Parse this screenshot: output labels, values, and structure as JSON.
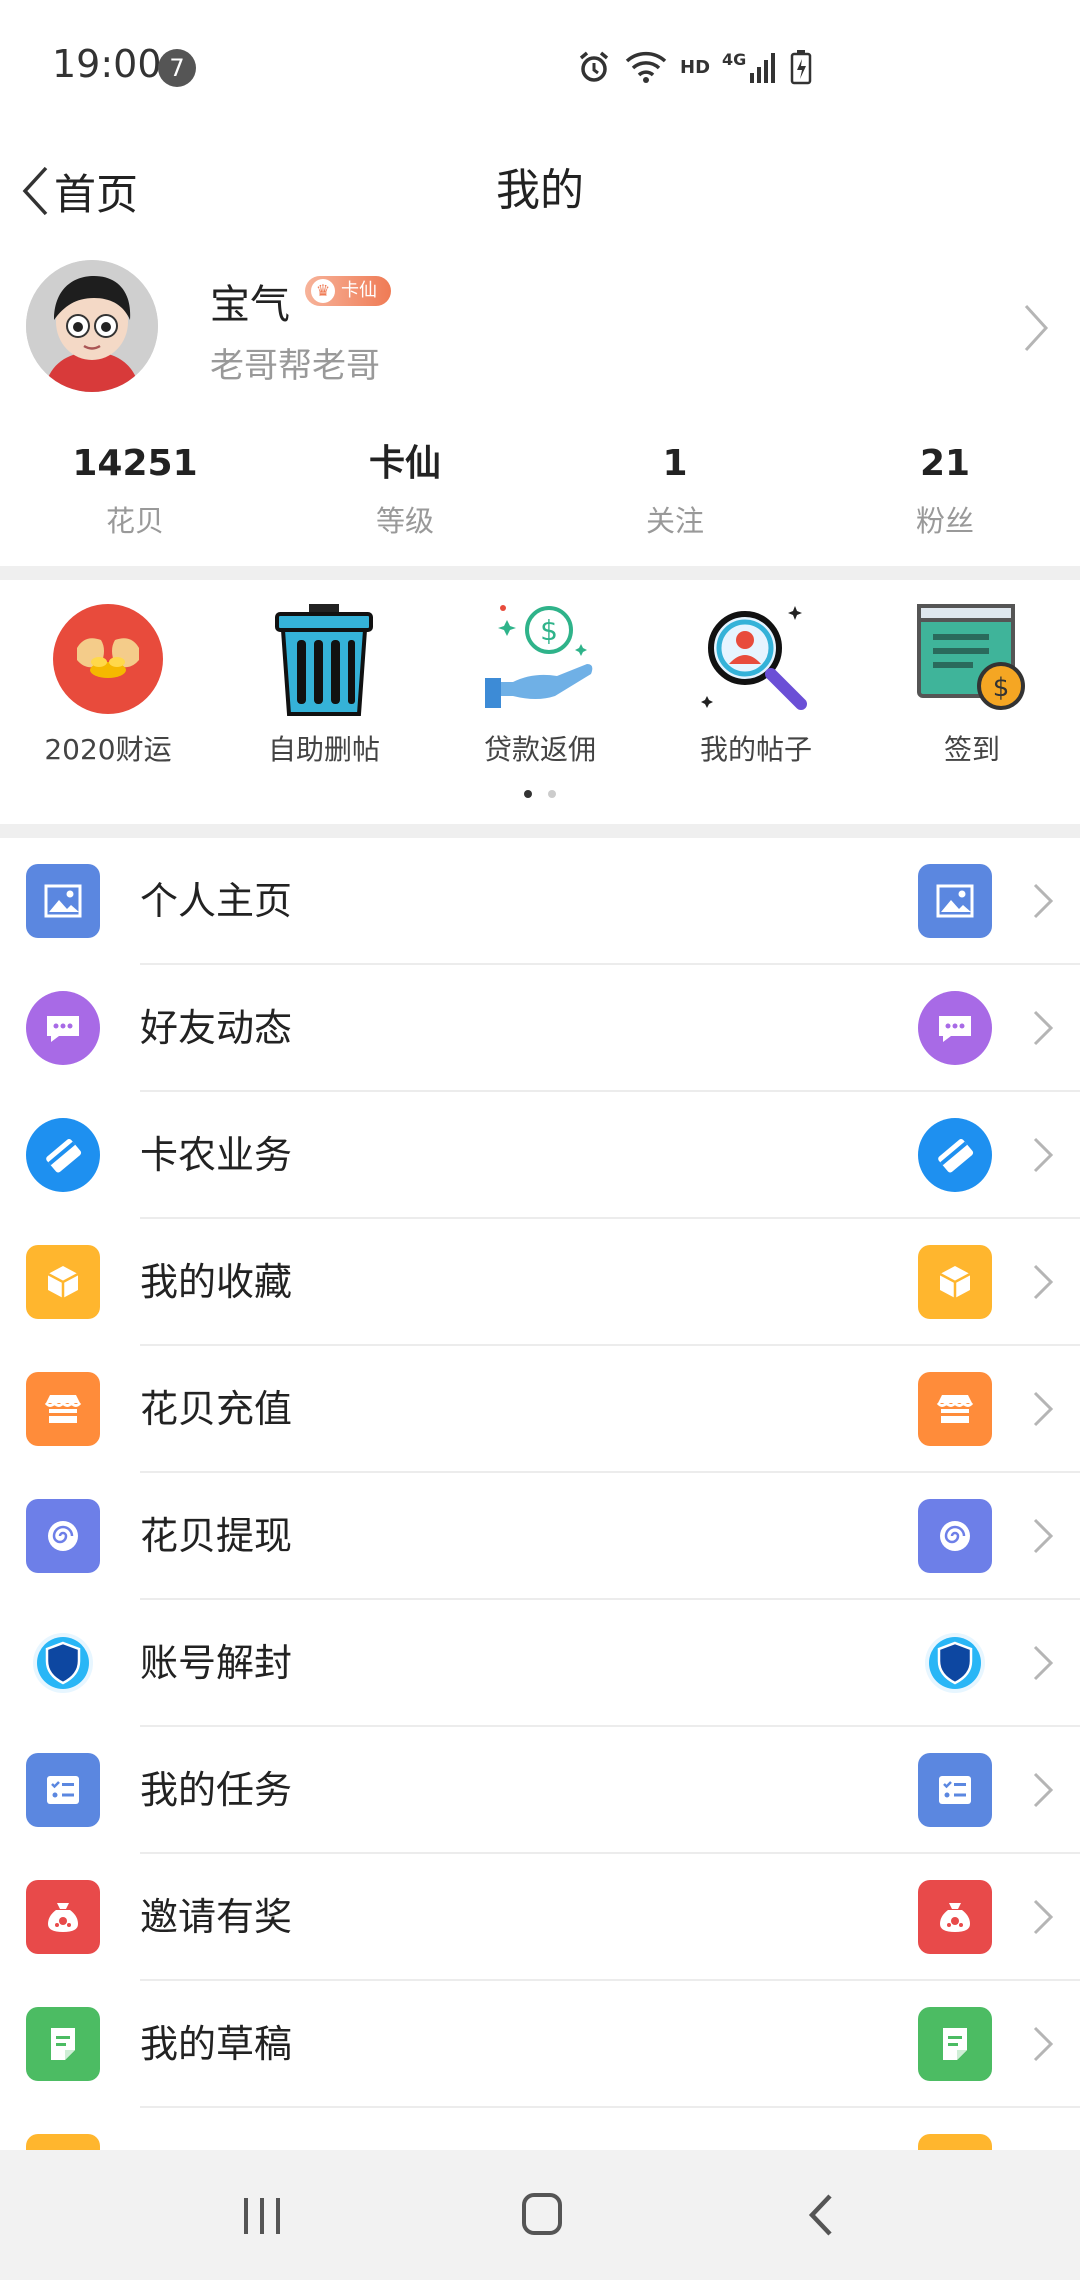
{
  "status_bar": {
    "time": "19:00",
    "notification_count": "7",
    "network_label": "HD",
    "network_type": "4G"
  },
  "nav": {
    "back_label": "首页",
    "title": "我的"
  },
  "profile": {
    "username": "宝气",
    "level_badge": "卡仙",
    "signature": "老哥帮老哥"
  },
  "stats": [
    {
      "value": "14251",
      "label": "花贝"
    },
    {
      "value": "卡仙",
      "label": "等级"
    },
    {
      "value": "1",
      "label": "关注"
    },
    {
      "value": "21",
      "label": "粉丝"
    }
  ],
  "quick_actions": [
    {
      "label": "2020财运",
      "icon": "fortune-icon"
    },
    {
      "label": "自助删帖",
      "icon": "trash-icon"
    },
    {
      "label": "贷款返佣",
      "icon": "money-hand-icon"
    },
    {
      "label": "我的帖子",
      "icon": "search-user-icon"
    },
    {
      "label": "签到",
      "icon": "signin-icon"
    }
  ],
  "pager": {
    "pages": 2,
    "active": 1
  },
  "menu": [
    {
      "label": "个人主页",
      "icon": "picture-icon",
      "color": "#5b87e0"
    },
    {
      "label": "好友动态",
      "icon": "chat-icon",
      "color": "#a86ae6"
    },
    {
      "label": "卡农业务",
      "icon": "card-icon",
      "color": "#1e90f0"
    },
    {
      "label": "我的收藏",
      "icon": "box-icon",
      "color": "#ffb62e"
    },
    {
      "label": "花贝充值",
      "icon": "store-icon",
      "color": "#ff8c3a"
    },
    {
      "label": "花贝提现",
      "icon": "swirl-icon",
      "color": "#6d7fe8"
    },
    {
      "label": "账号解封",
      "icon": "shield-icon",
      "color": "#1565c0"
    },
    {
      "label": "我的任务",
      "icon": "task-list-icon",
      "color": "#5b87e0"
    },
    {
      "label": "邀请有奖",
      "icon": "gift-bag-icon",
      "color": "#e84a4a"
    },
    {
      "label": "我的草稿",
      "icon": "draft-icon",
      "color": "#4cbc63"
    }
  ]
}
